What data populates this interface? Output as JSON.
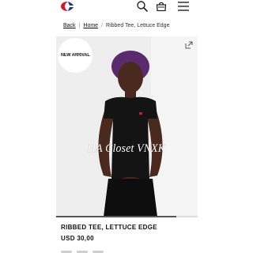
{
  "header": {
    "logo": "champion-logo",
    "icons": [
      "search-icon",
      "bag-icon",
      "menu-icon"
    ]
  },
  "breadcrumb": {
    "back": "Back",
    "home": "Home",
    "current": "Ribbed Tee, Lettuce Edge"
  },
  "gallery": {
    "badge": "NEW ARRIVAL",
    "watermark": "HA Closet VNXK",
    "progress_fraction": 0.85
  },
  "product": {
    "title": "RIBBED TEE, LETTUCE EDGE",
    "price": "USD 30,00"
  },
  "colors": {
    "brand_red": "#d3172b",
    "brand_blue": "#1f3a8a",
    "shirt": "#141414"
  }
}
